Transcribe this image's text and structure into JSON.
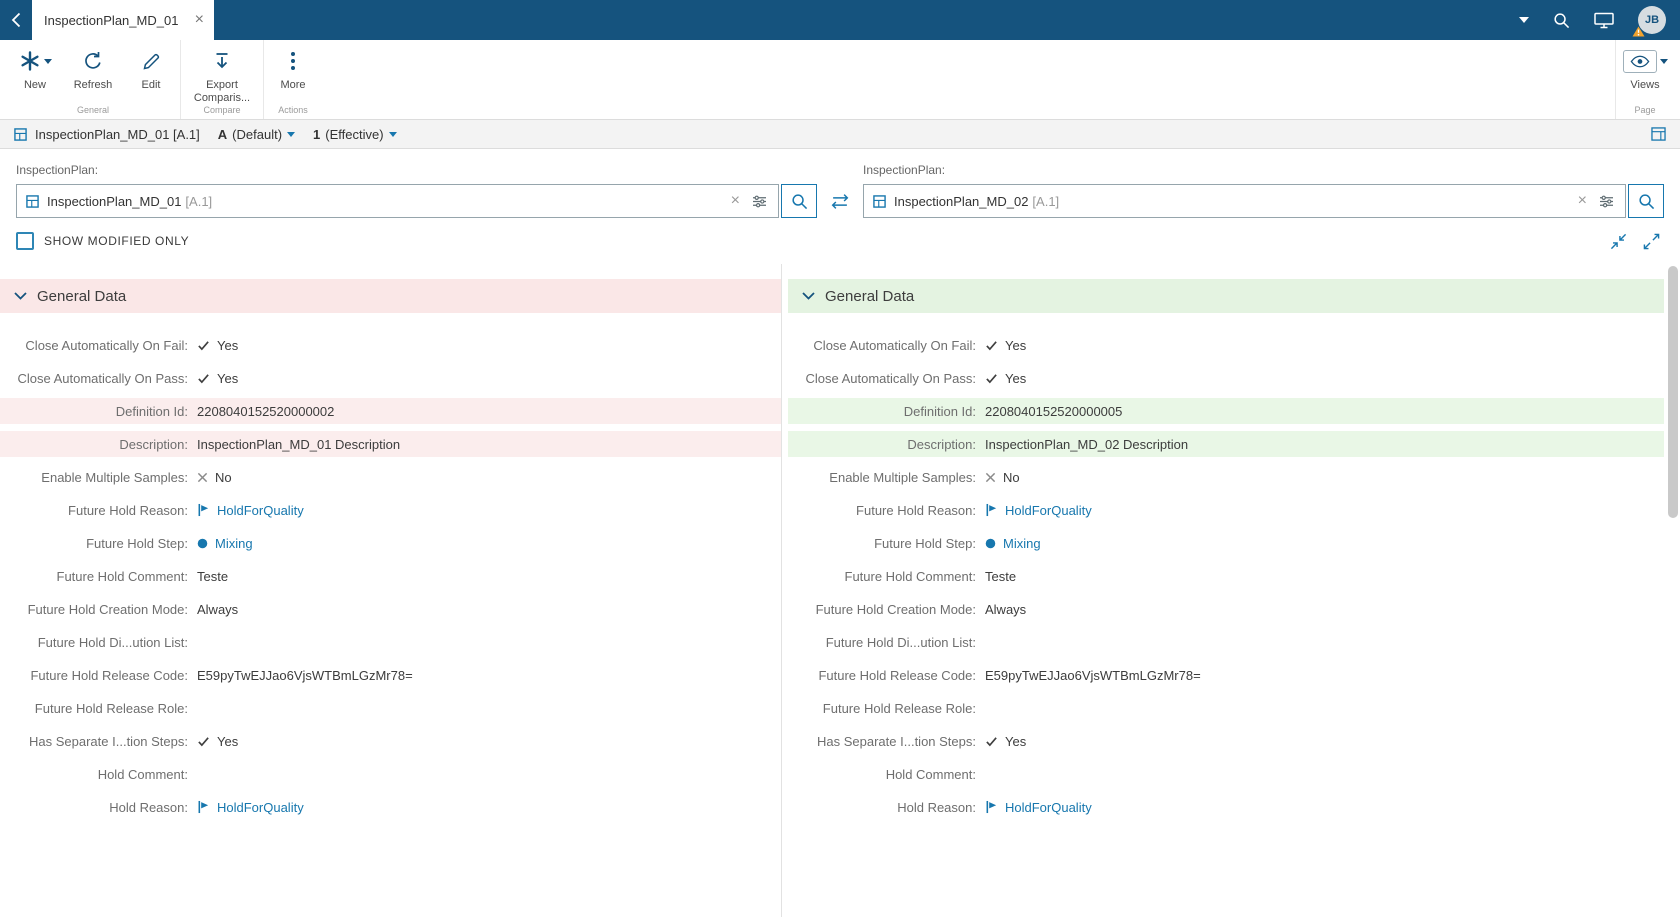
{
  "colors": {
    "topbar_bg": "#15537E",
    "accent_blue": "#1777AE",
    "modified_left_bg": "#FBEDED",
    "modified_right_bg": "#E9F7E6",
    "header_left_bg": "#FAE7E7",
    "header_right_bg": "#E4F3E1",
    "warning_orange": "#F0A22E"
  },
  "topbar": {
    "tab_title": "InspectionPlan_MD_01",
    "avatar_initials": "JB"
  },
  "toolbar": {
    "groups": [
      {
        "label": "General",
        "buttons": [
          {
            "label": "New",
            "icon": "asterisk-icon",
            "has_caret": true
          },
          {
            "label": "Refresh",
            "icon": "refresh-icon"
          },
          {
            "label": "Edit",
            "icon": "pencil-icon"
          }
        ]
      },
      {
        "label": "Compare",
        "buttons": [
          {
            "label": "Export Comparis...",
            "icon": "export-icon"
          }
        ]
      },
      {
        "label": "Actions",
        "buttons": [
          {
            "label": "More",
            "icon": "ellipsis-icon"
          }
        ]
      }
    ],
    "page_group": {
      "label": "Page",
      "buttons": [
        {
          "label": "Views",
          "icon": "eye-icon",
          "has_caret": true
        }
      ]
    }
  },
  "breadcrumb": {
    "entity": "InspectionPlan_MD_01 [A.1]",
    "version": "A",
    "version_label": "(Default)",
    "effectivity": "1",
    "effectivity_label": "(Effective)"
  },
  "compare": {
    "left": {
      "label": "InspectionPlan:",
      "value": "InspectionPlan_MD_01",
      "revision": "[A.1]"
    },
    "right": {
      "label": "InspectionPlan:",
      "value": "InspectionPlan_MD_02",
      "revision": "[A.1]"
    }
  },
  "options": {
    "show_modified_label": "SHOW MODIFIED ONLY"
  },
  "panels": {
    "left_title": "General Data",
    "right_title": "General Data",
    "rows": [
      {
        "label": "Close Automatically On Fail:",
        "left": {
          "icon": "check",
          "text": "Yes"
        },
        "right": {
          "icon": "check",
          "text": "Yes"
        }
      },
      {
        "label": "Close Automatically On Pass:",
        "left": {
          "icon": "check",
          "text": "Yes"
        },
        "right": {
          "icon": "check",
          "text": "Yes"
        }
      },
      {
        "label": "Definition Id:",
        "modified": true,
        "left": {
          "text": "2208040152520000002"
        },
        "right": {
          "text": "2208040152520000005"
        }
      },
      {
        "label": "Description:",
        "modified": true,
        "left": {
          "text": "InspectionPlan_MD_01 Description"
        },
        "right": {
          "text": "InspectionPlan_MD_02 Description"
        }
      },
      {
        "label": "Enable Multiple Samples:",
        "left": {
          "icon": "cross",
          "text": "No"
        },
        "right": {
          "icon": "cross",
          "text": "No"
        }
      },
      {
        "label": "Future Hold Reason:",
        "left": {
          "icon": "flag",
          "text": "HoldForQuality",
          "link": true
        },
        "right": {
          "icon": "flag",
          "text": "HoldForQuality",
          "link": true
        }
      },
      {
        "label": "Future Hold Step:",
        "left": {
          "icon": "dot",
          "text": "Mixing",
          "link": true
        },
        "right": {
          "icon": "dot",
          "text": "Mixing",
          "link": true
        }
      },
      {
        "label": "Future Hold Comment:",
        "left": {
          "text": "Teste"
        },
        "right": {
          "text": "Teste"
        }
      },
      {
        "label": "Future Hold Creation Mode:",
        "left": {
          "text": "Always"
        },
        "right": {
          "text": "Always"
        }
      },
      {
        "label": "Future Hold Di...ution List:",
        "left": {
          "text": ""
        },
        "right": {
          "text": ""
        }
      },
      {
        "label": "Future Hold Release Code:",
        "left": {
          "text": "E59pyTwEJJao6VjsWTBmLGzMr78="
        },
        "right": {
          "text": "E59pyTwEJJao6VjsWTBmLGzMr78="
        }
      },
      {
        "label": "Future Hold Release Role:",
        "left": {
          "text": ""
        },
        "right": {
          "text": ""
        }
      },
      {
        "label": "Has Separate I...tion Steps:",
        "left": {
          "icon": "check",
          "text": "Yes"
        },
        "right": {
          "icon": "check",
          "text": "Yes"
        }
      },
      {
        "label": "Hold Comment:",
        "left": {
          "text": ""
        },
        "right": {
          "text": ""
        }
      },
      {
        "label": "Hold Reason:",
        "left": {
          "icon": "flag",
          "text": "HoldForQuality",
          "link": true
        },
        "right": {
          "icon": "flag",
          "text": "HoldForQuality",
          "link": true
        }
      }
    ]
  }
}
